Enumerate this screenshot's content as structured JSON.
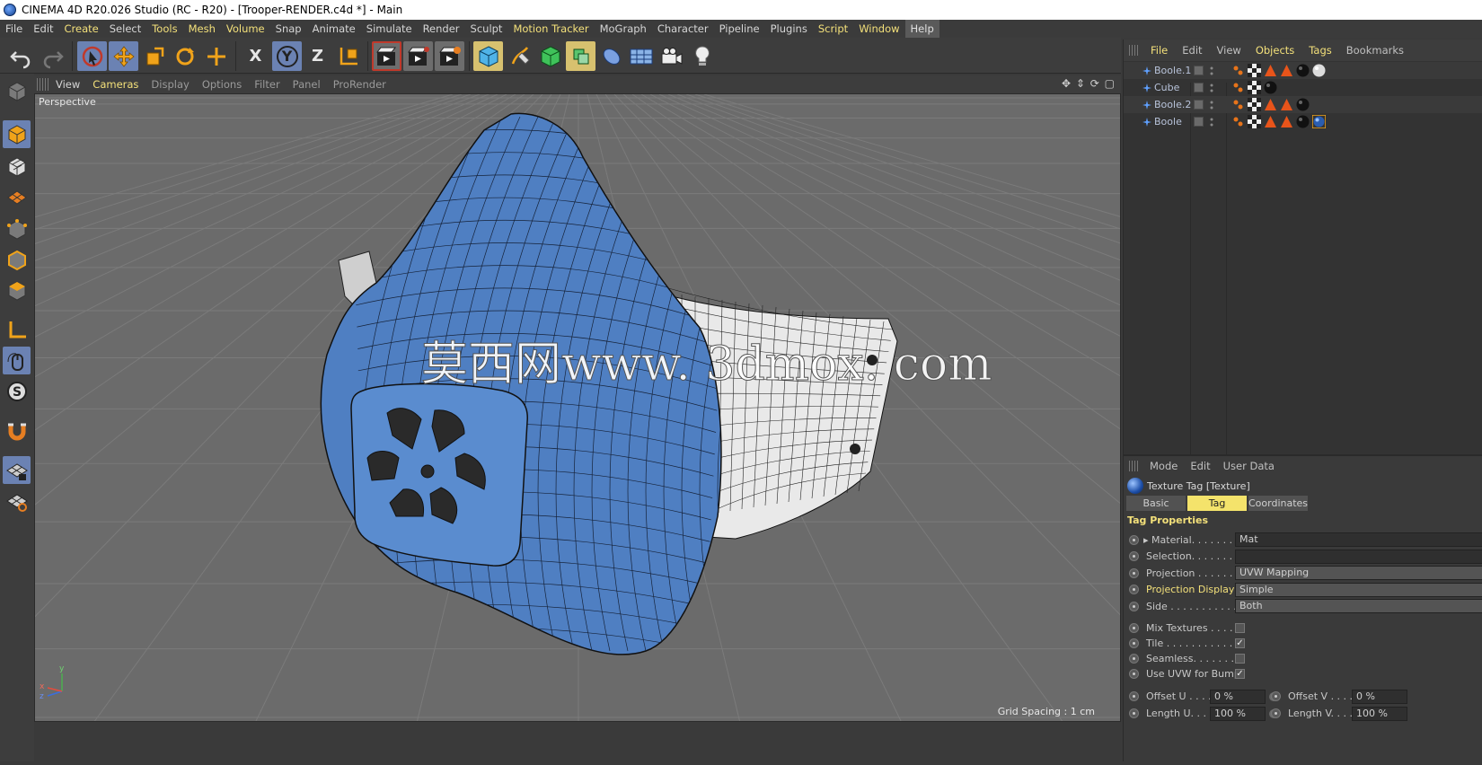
{
  "window": {
    "title": "CINEMA 4D R20.026 Studio (RC - R20) - [Trooper-RENDER.c4d *] - Main"
  },
  "menubar": {
    "items": [
      "File",
      "Edit",
      "Create",
      "Select",
      "Tools",
      "Mesh",
      "Volume",
      "Snap",
      "Animate",
      "Simulate",
      "Render",
      "Sculpt",
      "Motion Tracker",
      "MoGraph",
      "Character",
      "Pipeline",
      "Plugins",
      "Script",
      "Window",
      "Help"
    ],
    "highlighted": [
      "Create",
      "Tools",
      "Mesh",
      "Volume",
      "Motion Tracker",
      "Script",
      "Window"
    ]
  },
  "toolbar": {
    "tools": [
      "undo-icon",
      "redo-icon",
      "live-selection-icon",
      "move-icon",
      "scale-icon",
      "rotate-icon",
      "last-tool-icon",
      "x-axis-icon",
      "y-axis-icon",
      "z-axis-icon",
      "coordinate-system-icon",
      "render-view-icon",
      "render-picture-viewer-icon",
      "edit-render-settings-icon",
      "cube-icon",
      "pen-icon",
      "subdivision-icon",
      "array-icon",
      "deformer-icon",
      "floor-icon",
      "camera-icon",
      "light-icon"
    ],
    "axis_labels": [
      "X",
      "Y",
      "Z"
    ]
  },
  "leftbar": {
    "tools": [
      "make-editable-icon",
      "model-mode-icon",
      "texture-mode-icon",
      "workplane-icon",
      "points-mode-icon",
      "edges-mode-icon",
      "polygons-mode-icon",
      "axis-mode-icon",
      "tweak-icon",
      "solo-icon",
      "snap-icon",
      "lock-workplane-icon",
      "workplane-snap-icon"
    ]
  },
  "viewport": {
    "menu": [
      "View",
      "Cameras",
      "Display",
      "Options",
      "Filter",
      "Panel",
      "ProRender"
    ],
    "menu_highlighted": [
      "Cameras"
    ],
    "menu_lit": [
      "View"
    ],
    "label": "Perspective",
    "grid_spacing": "Grid Spacing : 1 cm",
    "nav_glyphs": "✥ ⇕ ⟳ ▢",
    "watermark": "莫西网www. 3dmox. com",
    "axis_y": "y",
    "axis_z": "z",
    "axis_x": "x"
  },
  "object_manager": {
    "menu": [
      "File",
      "Edit",
      "View",
      "Objects",
      "Tags",
      "Bookmarks"
    ],
    "menu_highlighted": [
      "File",
      "Objects",
      "Tags"
    ],
    "objects": [
      {
        "name": "Boole.1",
        "tags": [
          "checker",
          "triangle",
          "triangle",
          "sphere-black",
          "sphere-white"
        ]
      },
      {
        "name": "Cube",
        "tags": [
          "checker",
          "sphere-black"
        ]
      },
      {
        "name": "Boole.2",
        "tags": [
          "checker",
          "triangle",
          "triangle",
          "sphere-black"
        ]
      },
      {
        "name": "Boole",
        "tags": [
          "checker",
          "triangle",
          "triangle",
          "sphere-black",
          "sphere-blue-selected"
        ]
      }
    ]
  },
  "attribute_manager": {
    "menu": [
      "Mode",
      "Edit",
      "User Data"
    ],
    "title": "Texture Tag [Texture]",
    "tabs": [
      "Basic",
      "Tag",
      "Coordinates"
    ],
    "active_tab": "Tag",
    "section": "Tag Properties",
    "properties": [
      {
        "label": "Material. . . . . . . .",
        "value": "Mat",
        "type": "link"
      },
      {
        "label": "Selection. . . . . . .",
        "value": "",
        "type": "text"
      },
      {
        "label": "Projection . . . . . . . .",
        "value": "UVW Mapping",
        "type": "select"
      },
      {
        "label": "Projection Display",
        "value": "Simple",
        "type": "select",
        "highlighted": true
      },
      {
        "label": "Side . . . . . . . . . . . . .",
        "value": "Both",
        "type": "select"
      }
    ],
    "checks": [
      {
        "label": "Mix Textures . . . . .",
        "checked": false
      },
      {
        "label": "Tile . . . . . . . . . . . .",
        "checked": true
      },
      {
        "label": "Seamless. . . . . . . .",
        "checked": false
      },
      {
        "label": "Use UVW for Bump",
        "checked": true
      }
    ],
    "offset_u_label": "Offset U . . . .",
    "offset_u": "0 %",
    "offset_v_label": "Offset V . . . .",
    "offset_v": "0 %",
    "length_u_label": "Length U. . . .",
    "length_u": "100 %",
    "length_v_label": "Length V. . . .",
    "length_v": "100 %"
  },
  "colors": {
    "accent": "#f3e07a",
    "active_tool": "#6b82b3",
    "mask_blue": "#4f7fc2"
  }
}
